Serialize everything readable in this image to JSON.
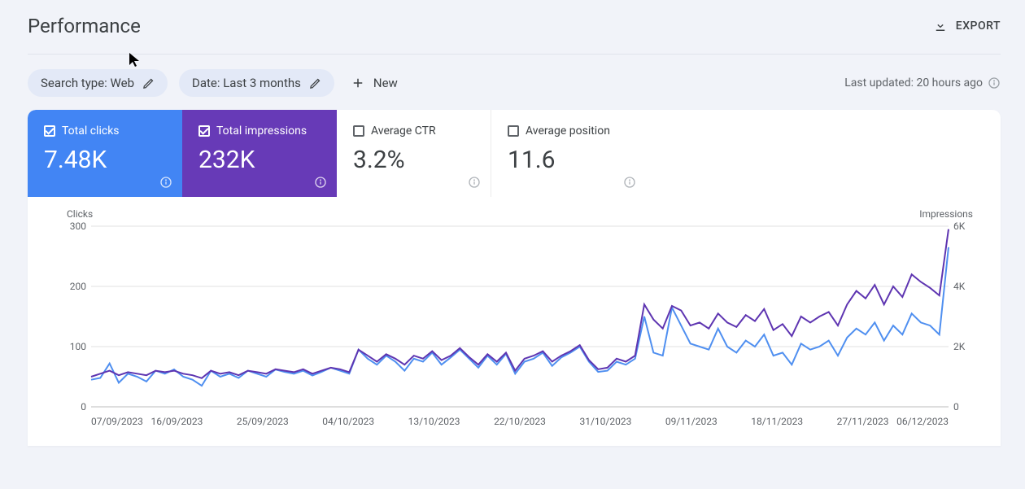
{
  "header": {
    "title": "Performance",
    "export": "EXPORT"
  },
  "filters": {
    "search_type": "Search type: Web",
    "date": "Date: Last 3 months",
    "new": "New",
    "updated": "Last updated: 20 hours ago"
  },
  "cards": {
    "clicks": {
      "label": "Total clicks",
      "value": "7.48K",
      "checked": true
    },
    "impressions": {
      "label": "Total impressions",
      "value": "232K",
      "checked": true
    },
    "ctr": {
      "label": "Average CTR",
      "value": "3.2%",
      "checked": false
    },
    "position": {
      "label": "Average position",
      "value": "11.6",
      "checked": false
    }
  },
  "chart_data": {
    "type": "line",
    "left_axis": {
      "label": "Clicks",
      "ticks": [
        0,
        100,
        200,
        300
      ],
      "max": 300
    },
    "right_axis": {
      "label": "Impressions",
      "ticks": [
        "0",
        "2K",
        "4K",
        "6K"
      ],
      "max": 6000
    },
    "x_categories": [
      "07/09/2023",
      "16/09/2023",
      "25/09/2023",
      "04/10/2023",
      "13/10/2023",
      "22/10/2023",
      "31/10/2023",
      "09/11/2023",
      "18/11/2023",
      "27/11/2023",
      "06/12/2023"
    ],
    "series": [
      {
        "name": "Clicks",
        "axis": "left",
        "color": "#4f8ff0",
        "values": [
          45,
          48,
          72,
          40,
          55,
          50,
          42,
          60,
          55,
          62,
          50,
          45,
          35,
          60,
          50,
          55,
          48,
          60,
          55,
          50,
          62,
          58,
          55,
          60,
          52,
          58,
          65,
          60,
          55,
          95,
          80,
          70,
          85,
          75,
          60,
          80,
          75,
          90,
          70,
          82,
          95,
          80,
          65,
          85,
          70,
          88,
          55,
          75,
          80,
          90,
          68,
          82,
          90,
          100,
          75,
          58,
          60,
          75,
          70,
          80,
          150,
          90,
          85,
          165,
          135,
          105,
          100,
          95,
          130,
          100,
          90,
          110,
          100,
          120,
          85,
          90,
          70,
          105,
          95,
          100,
          110,
          85,
          115,
          130,
          120,
          140,
          110,
          135,
          120,
          155,
          140,
          135,
          120,
          265
        ]
      },
      {
        "name": "Impressions",
        "axis": "right",
        "color": "#5e35b1",
        "values": [
          1000,
          1100,
          1200,
          1050,
          1150,
          1100,
          1050,
          1200,
          1150,
          1200,
          1100,
          1050,
          950,
          1200,
          1100,
          1150,
          1050,
          1200,
          1150,
          1100,
          1250,
          1200,
          1150,
          1250,
          1100,
          1200,
          1300,
          1250,
          1150,
          1900,
          1700,
          1500,
          1750,
          1600,
          1400,
          1700,
          1600,
          1850,
          1550,
          1700,
          1950,
          1650,
          1400,
          1750,
          1500,
          1800,
          1200,
          1600,
          1700,
          1850,
          1500,
          1700,
          1850,
          2050,
          1550,
          1250,
          1300,
          1600,
          1500,
          1700,
          3400,
          2900,
          2600,
          3350,
          3200,
          2700,
          2800,
          2600,
          3100,
          2800,
          2650,
          3050,
          2850,
          3250,
          2550,
          2750,
          2350,
          3000,
          2800,
          3000,
          3150,
          2700,
          3400,
          3850,
          3600,
          4050,
          3400,
          4000,
          3650,
          4400,
          4150,
          3950,
          3700,
          5900
        ]
      }
    ]
  }
}
